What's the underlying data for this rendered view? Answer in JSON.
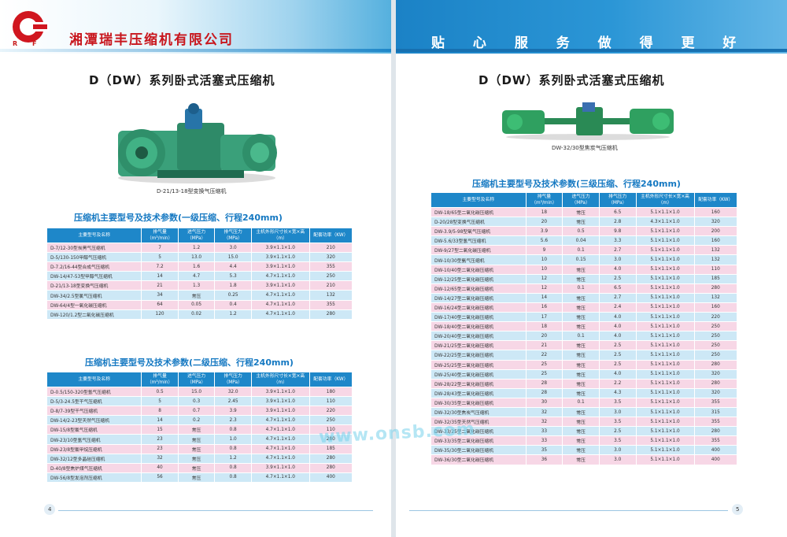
{
  "company": "湘潭瑞丰压缩机有限公司",
  "logo_letters": "R F",
  "slogan": "贴 心 服 务 做 得 更 好",
  "left_page": {
    "title": "D（DW）系列卧式活塞式压缩机",
    "photo_caption": "D-21/13-18型变换气压缩机",
    "page_number": "4",
    "tables": [
      {
        "title": "压缩机主要型号及技术参数(一级压缩、行程240mm)",
        "headers": [
          "主要型号及名称",
          "排气量（m³/min）",
          "进气压力（MPa）",
          "排气压力（MPa）",
          "主机外形尺寸长×宽×高（m）",
          "配套功率（KW）"
        ],
        "rows": [
          [
            "D-7/12-30型炭黑气压缩机",
            "7",
            "1.2",
            "3.0",
            "3.9×1.1×1.0",
            "210"
          ],
          [
            "D-5/130-150甲醇气压缩机",
            "5",
            "13.0",
            "15.0",
            "3.9×1.1×1.0",
            "320"
          ],
          [
            "D-7.2/16-44型合成气压缩机",
            "7.2",
            "1.6",
            "4.4",
            "3.9×1.1×1.0",
            "355"
          ],
          [
            "DW-14/47-53型甲醇气压缩机",
            "14",
            "4.7",
            "5.3",
            "4.7×1.1×1.0",
            "250"
          ],
          [
            "D-21/13-18型变换气压缩机",
            "21",
            "1.3",
            "1.8",
            "3.9×1.1×1.0",
            "210"
          ],
          [
            "DW-34/2.5型氯气压缩机",
            "34",
            "常压",
            "0.25",
            "4.7×1.1×1.0",
            "132"
          ],
          [
            "DW-64/4型一氧化碳压缩机",
            "64",
            "0.05",
            "0.4",
            "4.7×1.1×1.0",
            "355"
          ],
          [
            "DW-120/1.2型二氧化碳压缩机",
            "120",
            "0.02",
            "1.2",
            "4.7×1.1×1.0",
            "280"
          ]
        ]
      },
      {
        "title": "压缩机主要型号及技术参数(二级压缩、行程240mm)",
        "headers": [
          "主要型号及名称",
          "排气量（m³/min）",
          "进气压力（MPa）",
          "排气压力（MPa）",
          "主机外形尺寸长×宽×高（m）",
          "配套功率（KW）"
        ],
        "rows": [
          [
            "D-0.5/150-320型氢气压缩机",
            "0.5",
            "15.0",
            "32.0",
            "3.9×1.1×1.0",
            "180"
          ],
          [
            "D-5/3-24.5型干气压缩机",
            "5",
            "0.3",
            "2.45",
            "3.9×1.1×1.0",
            "110"
          ],
          [
            "D-8/7-39型干气压缩机",
            "8",
            "0.7",
            "3.9",
            "3.9×1.1×1.0",
            "220"
          ],
          [
            "DW-14/2-23型天然气压缩机",
            "14",
            "0.2",
            "2.3",
            "4.7×1.1×1.0",
            "250"
          ],
          [
            "DW-15/8型氯气压缩机",
            "15",
            "常压",
            "0.8",
            "4.7×1.1×1.0",
            "110"
          ],
          [
            "DW-23/10型氢气压缩机",
            "23",
            "常压",
            "1.0",
            "4.7×1.1×1.0",
            "280"
          ],
          [
            "DW-23/8型氯甲烷压缩机",
            "23",
            "常压",
            "0.8",
            "4.7×1.1×1.0",
            "185"
          ],
          [
            "DW-32/12型多晶硅压缩机",
            "32",
            "常压",
            "1.2",
            "4.7×1.1×1.0",
            "280"
          ],
          [
            "D-40/8型焦炉煤气压缩机",
            "40",
            "常压",
            "0.8",
            "3.9×1.1×1.0",
            "280"
          ],
          [
            "DW-56/8型发泡剂压缩机",
            "56",
            "常压",
            "0.8",
            "4.7×1.1×1.0",
            "400"
          ]
        ]
      }
    ]
  },
  "right_page": {
    "title": "D（DW）系列卧式活塞式压缩机",
    "photo_caption": "DW-32/30型焦炭气压缩机",
    "page_number": "5",
    "table": {
      "title": "压缩机主要型号及技术参数(三级压缩、行程240mm)",
      "headers": [
        "主要型号及名称",
        "排气量（m³/min）",
        "进气压力（MPa）",
        "排气压力（MPa）",
        "主机外形尺寸长×宽×高（m）",
        "配套功率（KW）"
      ],
      "rows": [
        [
          "DW-18/65型二氧化碳压缩机",
          "18",
          "常压",
          "6.5",
          "5.1×1.1×1.0",
          "160"
        ],
        [
          "D-20/28型变换气压缩机",
          "20",
          "常压",
          "2.8",
          "4.3×1.1×1.0",
          "320"
        ],
        [
          "DW-3.9/5-98型氧气压缩机",
          "3.9",
          "0.5",
          "9.8",
          "5.1×1.1×1.0",
          "200"
        ],
        [
          "DW-5.6/33型氢气压缩机",
          "5.6",
          "0.04",
          "3.3",
          "5.1×1.1×1.0",
          "160"
        ],
        [
          "DW-9/27型二氧化碳压缩机",
          "9",
          "0.1",
          "2.7",
          "5.1×1.1×1.0",
          "132"
        ],
        [
          "DW-10/30型氨气压缩机",
          "10",
          "0.15",
          "3.0",
          "5.1×1.1×1.0",
          "132"
        ],
        [
          "DW-10/40型二氧化碳压缩机",
          "10",
          "常压",
          "4.0",
          "5.1×1.1×1.0",
          "110"
        ],
        [
          "DW-12/25型二氧化碳压缩机",
          "12",
          "常压",
          "2.5",
          "5.1×1.1×1.0",
          "185"
        ],
        [
          "DW-12/65型二氧化碳压缩机",
          "12",
          "0.1",
          "6.5",
          "5.1×1.1×1.0",
          "280"
        ],
        [
          "DW-14/27型二氧化碳压缩机",
          "14",
          "常压",
          "2.7",
          "5.1×1.1×1.0",
          "132"
        ],
        [
          "DW-16/24型二氧化碳压缩机",
          "16",
          "常压",
          "2.4",
          "5.1×1.1×1.0",
          "160"
        ],
        [
          "DW-17/40型二氧化碳压缩机",
          "17",
          "常压",
          "4.0",
          "5.1×1.1×1.0",
          "220"
        ],
        [
          "DW-18/40型二氧化碳压缩机",
          "18",
          "常压",
          "4.0",
          "5.1×1.1×1.0",
          "250"
        ],
        [
          "DW-20/40型二氧化碳压缩机",
          "20",
          "0.1",
          "4.0",
          "5.1×1.1×1.0",
          "250"
        ],
        [
          "DW-21/25型二氧化碳压缩机",
          "21",
          "常压",
          "2.5",
          "5.1×1.1×1.0",
          "250"
        ],
        [
          "DW-22/25型二氧化碳压缩机",
          "22",
          "常压",
          "2.5",
          "5.1×1.1×1.0",
          "250"
        ],
        [
          "DW-25/25型二氧化碳压缩机",
          "25",
          "常压",
          "2.5",
          "5.1×1.1×1.0",
          "280"
        ],
        [
          "DW-25/40型二氧化碳压缩机",
          "25",
          "常压",
          "4.0",
          "5.1×1.1×1.0",
          "320"
        ],
        [
          "DW-28/22型二氧化碳压缩机",
          "28",
          "常压",
          "2.2",
          "5.1×1.1×1.0",
          "280"
        ],
        [
          "DW-28/43型二氧化碳压缩机",
          "28",
          "常压",
          "4.3",
          "5.1×1.1×1.0",
          "320"
        ],
        [
          "DW-30/35型二氧化碳压缩机",
          "30",
          "0.1",
          "3.5",
          "5.1×1.1×1.0",
          "355"
        ],
        [
          "DW-32/30型焦炭气压缩机",
          "32",
          "常压",
          "3.0",
          "5.1×1.1×1.0",
          "315"
        ],
        [
          "DW-32/35型天然气压缩机",
          "32",
          "常压",
          "3.5",
          "5.1×1.1×1.0",
          "355"
        ],
        [
          "DW-33/25型二氧化碳压缩机",
          "33",
          "常压",
          "2.5",
          "5.1×1.1×1.0",
          "280"
        ],
        [
          "DW-33/35型二氧化碳压缩机",
          "33",
          "常压",
          "3.5",
          "5.1×1.1×1.0",
          "355"
        ],
        [
          "DW-35/30型二氧化碳压缩机",
          "35",
          "常压",
          "3.0",
          "5.1×1.1×1.0",
          "400"
        ],
        [
          "DW-36/30型二氧化碳压缩机",
          "36",
          "常压",
          "3.0",
          "5.1×1.1×1.0",
          "400"
        ]
      ]
    }
  },
  "watermark": "www.onsb.com",
  "colors": {
    "brand_red": "#c8161d",
    "brand_blue": "#1e87c9",
    "row_pink": "#f7d7e6",
    "row_blue": "#cde8f6"
  }
}
